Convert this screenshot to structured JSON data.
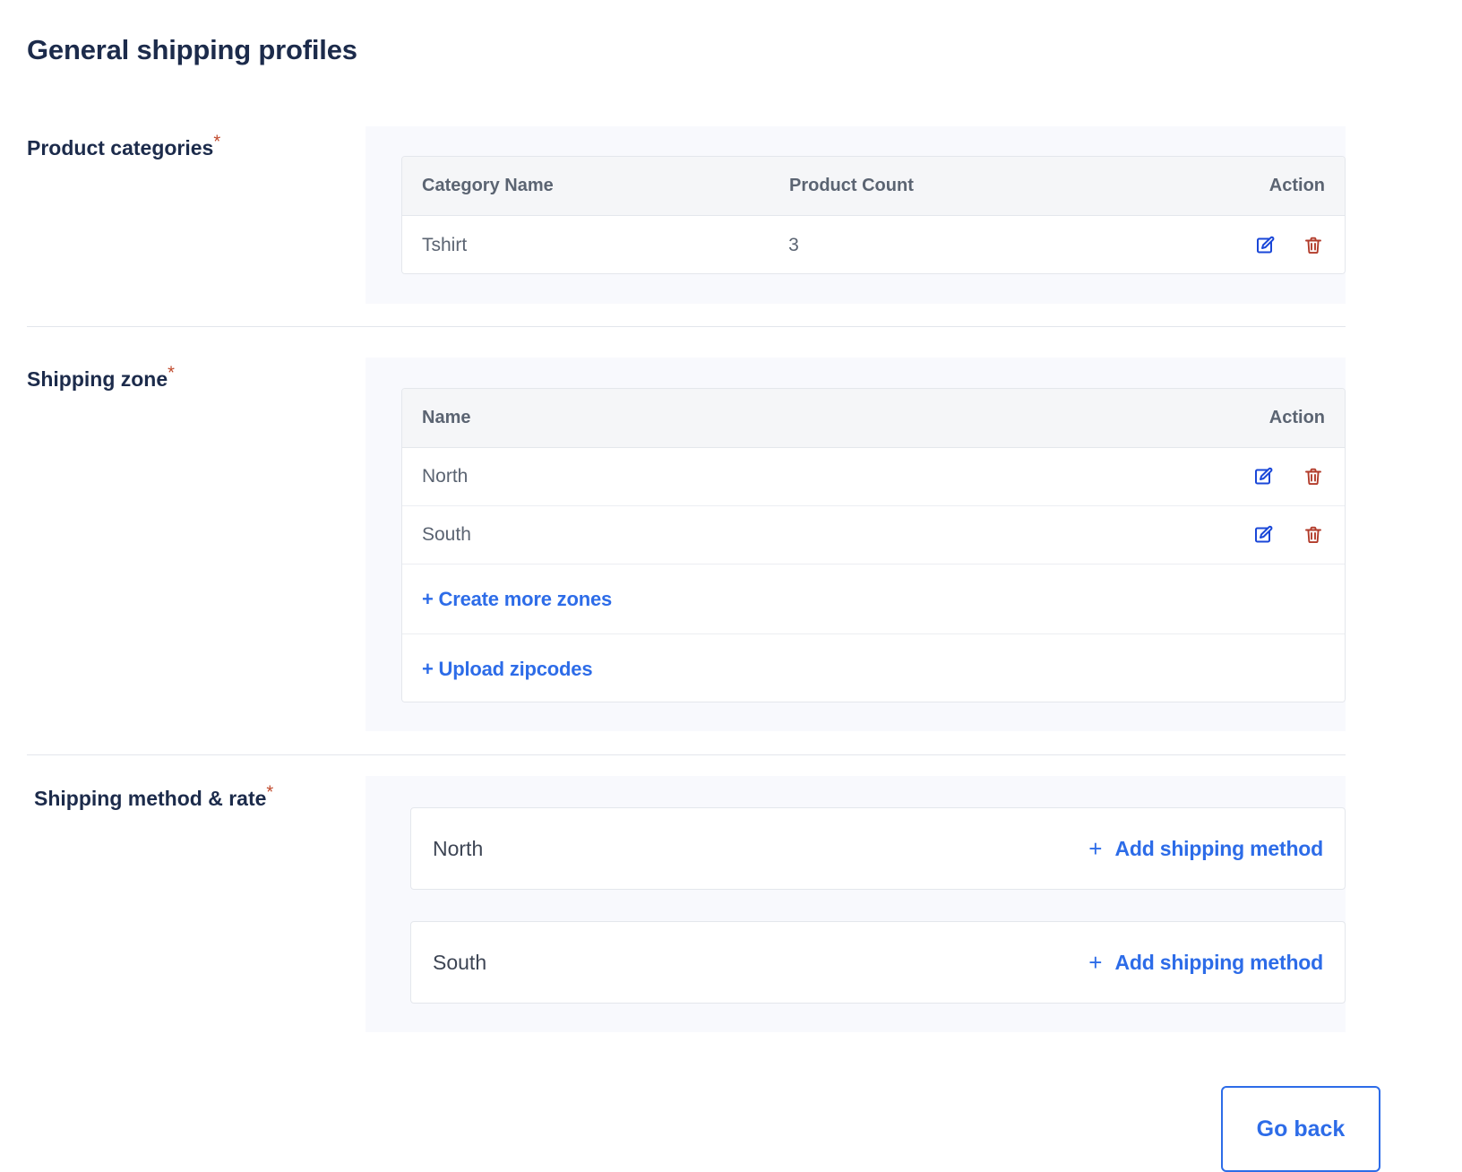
{
  "page": {
    "title": "General shipping profiles",
    "required_marker": "*"
  },
  "colors": {
    "accent_blue": "#2d6ce8",
    "title_navy": "#1c2b4b",
    "required_red": "#c0492c",
    "delete_red": "#b23b2a",
    "panel_bg": "#f8f9fd",
    "table_header_bg": "#f5f6f8"
  },
  "product_categories": {
    "label": "Product categories",
    "columns": [
      "Category Name",
      "Product Count",
      "Action"
    ],
    "rows": [
      {
        "category_name": "Tshirt",
        "product_count": "3"
      }
    ],
    "actions": {
      "edit_icon": "edit-pencil-square-icon",
      "delete_icon": "trash-icon"
    }
  },
  "shipping_zone": {
    "label": "Shipping zone",
    "columns": [
      "Name",
      "Action"
    ],
    "rows": [
      {
        "name": "North"
      },
      {
        "name": "South"
      }
    ],
    "links": [
      {
        "label": "+ Create more zones"
      },
      {
        "label": "+ Upload zipcodes"
      }
    ]
  },
  "shipping_method_rate": {
    "label": "Shipping method & rate",
    "zones": [
      {
        "name": "North",
        "add_plus": "+",
        "add_label": "Add shipping method"
      },
      {
        "name": "South",
        "add_plus": "+",
        "add_label": "Add shipping method"
      }
    ]
  },
  "footer": {
    "go_back_label": "Go back"
  }
}
